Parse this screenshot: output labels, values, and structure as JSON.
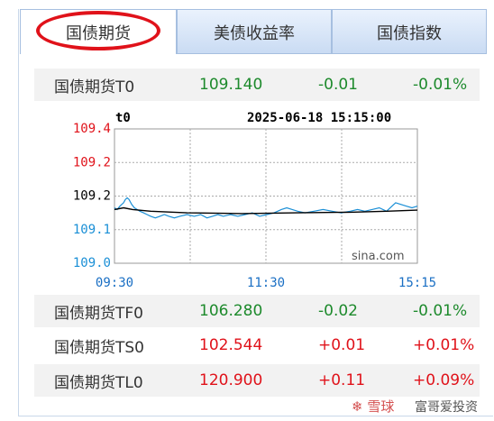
{
  "tabs": [
    {
      "label": "国债期货",
      "active": true
    },
    {
      "label": "美债收益率",
      "active": false
    },
    {
      "label": "国债指数",
      "active": false
    }
  ],
  "top_row": {
    "name": "国债期货T0",
    "price": "109.140",
    "change": "-0.01",
    "pct": "-0.01%"
  },
  "chart": {
    "symbol": "t0",
    "datetime": "2025-06-18 15:15:00",
    "watermark": "sina.com",
    "y_tick_labels": [
      "109.4",
      "109.2",
      "109.2",
      "109.1",
      "109.0"
    ],
    "x_tick_labels": [
      "09:30",
      "11:30",
      "15:15"
    ]
  },
  "chart_data": {
    "type": "line",
    "title": "t0",
    "subtitle": "2025-06-18 15:15:00",
    "xlabel": "",
    "ylabel": "",
    "x_ticks": [
      "09:30",
      "11:30",
      "15:15"
    ],
    "y_ticks": [
      "109.4",
      "109.2",
      "109.2",
      "109.1",
      "109.0"
    ],
    "ylim": [
      109.0,
      109.4
    ],
    "grid": true,
    "series": [
      {
        "color": "#1a8fd6",
        "x": [
          0,
          3,
          6,
          8,
          10,
          12,
          14,
          16,
          19,
          22,
          25,
          28,
          32,
          36,
          40,
          45,
          50,
          55,
          60,
          66,
          72,
          80,
          88,
          95,
          102,
          108,
          114,
          120,
          128,
          136,
          144,
          152,
          160,
          168,
          176,
          184,
          190,
          196,
          202,
          210,
          220,
          230,
          240,
          250,
          260,
          268,
          276,
          284,
          292,
          300,
          306,
          310,
          316,
          322,
          328,
          334
        ],
        "values": [
          109.165,
          109.16,
          109.17,
          109.175,
          109.18,
          109.19,
          109.195,
          109.19,
          109.175,
          109.165,
          109.16,
          109.155,
          109.15,
          109.145,
          109.14,
          109.135,
          109.14,
          109.145,
          109.14,
          109.135,
          109.14,
          109.145,
          109.14,
          109.145,
          109.135,
          109.14,
          109.145,
          109.14,
          109.145,
          109.14,
          109.145,
          109.15,
          109.14,
          109.145,
          109.15,
          109.16,
          109.165,
          109.16,
          109.155,
          109.15,
          109.155,
          109.16,
          109.155,
          109.15,
          109.155,
          109.16,
          109.155,
          109.16,
          109.165,
          109.155,
          109.17,
          109.18,
          109.175,
          109.17,
          109.165,
          109.17
        ]
      },
      {
        "color": "#000000",
        "x": [
          0,
          10,
          20,
          40,
          80,
          140,
          200,
          260,
          300,
          334
        ],
        "values": [
          109.16,
          109.165,
          109.16,
          109.155,
          109.15,
          109.148,
          109.15,
          109.152,
          109.155,
          109.158
        ]
      }
    ]
  },
  "rows": [
    {
      "name": "国债期货TF0",
      "price": "106.280",
      "change": "-0.02",
      "pct": "-0.01%",
      "color": "#1d8a2c"
    },
    {
      "name": "国债期货TS0",
      "price": "102.544",
      "change": "+0.01",
      "pct": "+0.01%",
      "color": "#e0121a"
    },
    {
      "name": "国债期货TL0",
      "price": "120.900",
      "change": "+0.11",
      "pct": "+0.09%",
      "color": "#e0121a"
    }
  ],
  "watermark": {
    "logo": "❄ 雪球",
    "text": "富哥爱投资"
  },
  "colors": {
    "up": "#e0121a",
    "down": "#1d8a2c",
    "line": "#1a8fd6",
    "avg": "#000000",
    "tab_border": "#a6bfe0"
  }
}
